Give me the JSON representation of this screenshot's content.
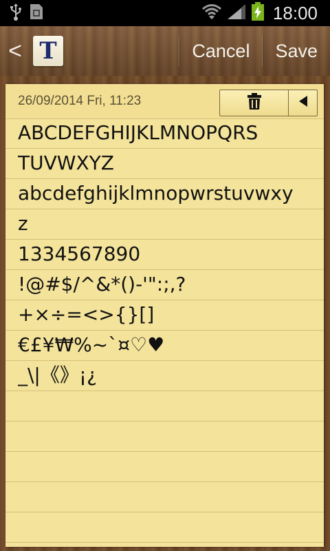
{
  "status_bar": {
    "left_icons": [
      "usb-icon",
      "sim-icon"
    ],
    "right_icons": [
      "wifi-icon",
      "signal-icon",
      "battery-charging-icon"
    ],
    "time": "18:00"
  },
  "action_bar": {
    "back_glyph": "<",
    "app_icon_letter": "T",
    "cancel_label": "Cancel",
    "save_label": "Save"
  },
  "note": {
    "datetime": "26/09/2014 Fri, 11:23",
    "lines": [
      "ABCDEFGHIJKLMNOPQRS",
      "TUVWXYZ",
      "abcdefghijklmnopwrstuvwxy",
      "z",
      "1334567890",
      "!@#$/^&*()-'\":;,?",
      "+×÷=<>{}[]",
      "€£¥₩%~`¤♡♥",
      "_\\|《》¡¿"
    ]
  }
}
